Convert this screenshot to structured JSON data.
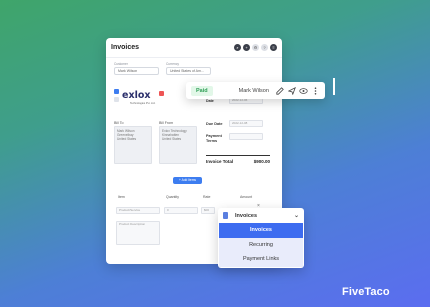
{
  "card": {
    "title": "Invoices",
    "customer_label": "Customer",
    "customer_value": "Mark Wilson",
    "currency_label": "Currency",
    "currency_value": "United States of Am...",
    "logo_text": "exlox",
    "logo_sub": "Technologies Pvt. Ltd.",
    "date_label": "Date",
    "date_value": "2022-12-06",
    "due_date_label": "Due Date",
    "due_date_value": "2022-12-08",
    "payment_terms_label": "Payment Terms",
    "bill_to_label": "Bill To",
    "bill_to_lines": [
      "Mark Wilson",
      "Greenelbay",
      "United States"
    ],
    "bill_from_label": "Bill From",
    "bill_from_lines": [
      "Exlox Technology",
      "Kinnahatten",
      "United States"
    ],
    "invoice_total_label": "Invoice Total",
    "invoice_total_value": "$900.00",
    "add_button": "+ Add Items",
    "columns": [
      "Item",
      "Quantity",
      "Rate",
      "Amount"
    ],
    "product_placeholder": "Product/Service",
    "quantity_value": "0",
    "rate_value": "$00",
    "description_placeholder": "Product Description"
  },
  "toolbar": {
    "status": "Paid",
    "name": "Mark Wilson"
  },
  "dropdown": {
    "title": "Invoices",
    "items": [
      "Invoices",
      "Recurring",
      "Payment Links"
    ],
    "active": "Invoices"
  },
  "brand": "FiveTaco",
  "colors": {
    "accent": "#3d6cf0",
    "paid_text": "#2e9e55",
    "paid_bg": "#e2f7e8"
  }
}
